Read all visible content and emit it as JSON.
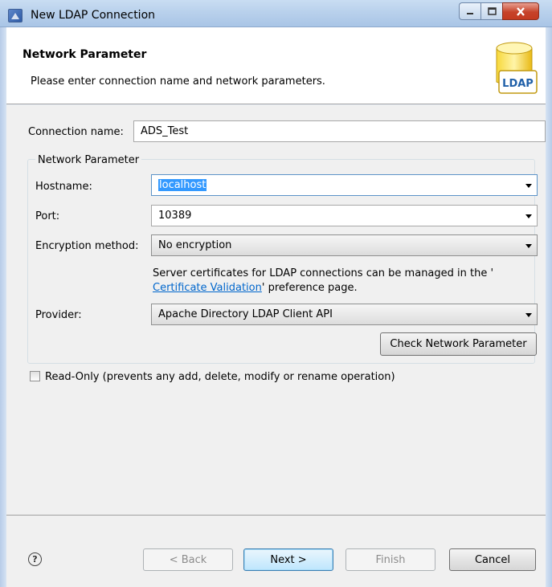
{
  "window": {
    "title": "New LDAP Connection"
  },
  "header": {
    "heading": "Network Parameter",
    "description": "Please enter connection name and network parameters.",
    "badge": "LDAP"
  },
  "form": {
    "connection_name_label": "Connection name:",
    "connection_name_value": "ADS_Test",
    "group_title": "Network Parameter",
    "hostname_label": "Hostname:",
    "hostname_value": "localhost",
    "port_label": "Port:",
    "port_value": "10389",
    "encryption_label": "Encryption method:",
    "encryption_value": "No encryption",
    "note_prefix": "Server certificates for LDAP connections can be managed in the '",
    "note_link": "Certificate Validation",
    "note_suffix": "' preference page.",
    "provider_label": "Provider:",
    "provider_value": "Apache Directory LDAP Client API",
    "check_button": "Check Network Parameter",
    "readonly_label": "Read-Only (prevents any add, delete, modify or rename operation)",
    "readonly_checked": false
  },
  "footer": {
    "help_glyph": "?",
    "back": "< Back",
    "next": "Next >",
    "finish": "Finish",
    "cancel": "Cancel"
  },
  "colors": {
    "selection": "#3399ff",
    "link": "#0066cc",
    "close_button": "#c43a1f"
  }
}
